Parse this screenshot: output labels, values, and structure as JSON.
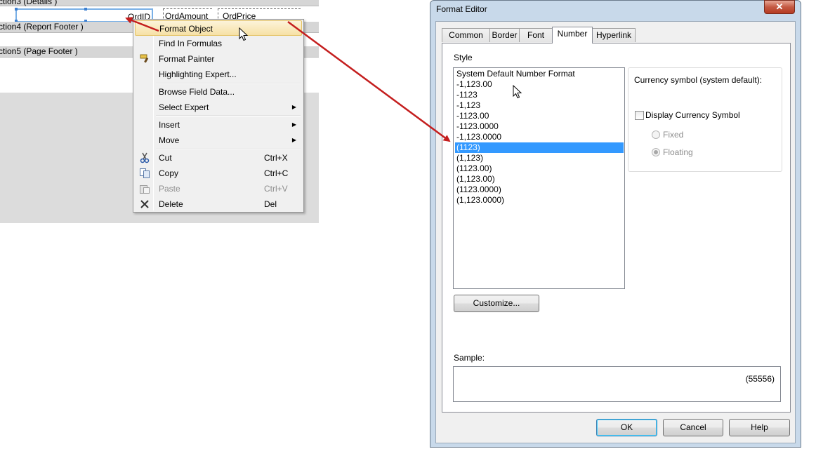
{
  "designer": {
    "section3_label": "ction3 (Details  )",
    "section4_label": "ction4 (Report Footer  )",
    "section5_label": "ction5 (Page Footer  )",
    "fields": {
      "ordid": "OrdID",
      "ordamount": "OrdAmount",
      "ordprice": "OrdPrice"
    }
  },
  "context_menu": {
    "items": [
      {
        "label": "Format Object",
        "highlighted": true
      },
      {
        "label": "Find In Formulas"
      },
      {
        "label": "Format Painter",
        "icon": "format-painter-icon"
      },
      {
        "label": "Highlighting Expert..."
      },
      {
        "label": "Browse Field Data..."
      },
      {
        "label": "Select Expert",
        "submenu": true
      },
      {
        "label": "Insert",
        "submenu": true
      },
      {
        "label": "Move",
        "submenu": true
      },
      {
        "label": "Cut",
        "shortcut": "Ctrl+X",
        "icon": "cut-icon"
      },
      {
        "label": "Copy",
        "shortcut": "Ctrl+C",
        "icon": "copy-icon"
      },
      {
        "label": "Paste",
        "shortcut": "Ctrl+V",
        "icon": "paste-icon",
        "disabled": true
      },
      {
        "label": "Delete",
        "shortcut": "Del",
        "icon": "delete-icon"
      }
    ]
  },
  "dialog": {
    "title": "Format Editor",
    "close_label": "✕",
    "tabs": [
      {
        "label": "Common"
      },
      {
        "label": "Border"
      },
      {
        "label": "Font"
      },
      {
        "label": "Number",
        "active": true
      },
      {
        "label": "Hyperlink"
      }
    ],
    "style_label": "Style",
    "styles": [
      "System Default Number Format",
      "-1,123.00",
      "-1123",
      "-1,123",
      "-1123.00",
      "-1123.0000",
      "-1,123.0000",
      "(1123)",
      "(1,123)",
      "(1123.00)",
      "(1,123.00)",
      "(1123.0000)",
      "(1,123.0000)"
    ],
    "selected_style": "(1123)",
    "currency_label": "Currency symbol (system default):",
    "display_currency_label": "Display Currency Symbol",
    "display_currency_checked": false,
    "radio_fixed": "Fixed",
    "radio_floating": "Floating",
    "radio_selected": "Floating",
    "customize_label": "Customize...",
    "sample_label": "Sample:",
    "sample_value": "(55556)",
    "ok_label": "OK",
    "cancel_label": "Cancel",
    "help_label": "Help"
  },
  "colors": {
    "arrow": "#c41e1e",
    "selection": "#3399ff",
    "menu_highlight": "#f6e1a6"
  }
}
